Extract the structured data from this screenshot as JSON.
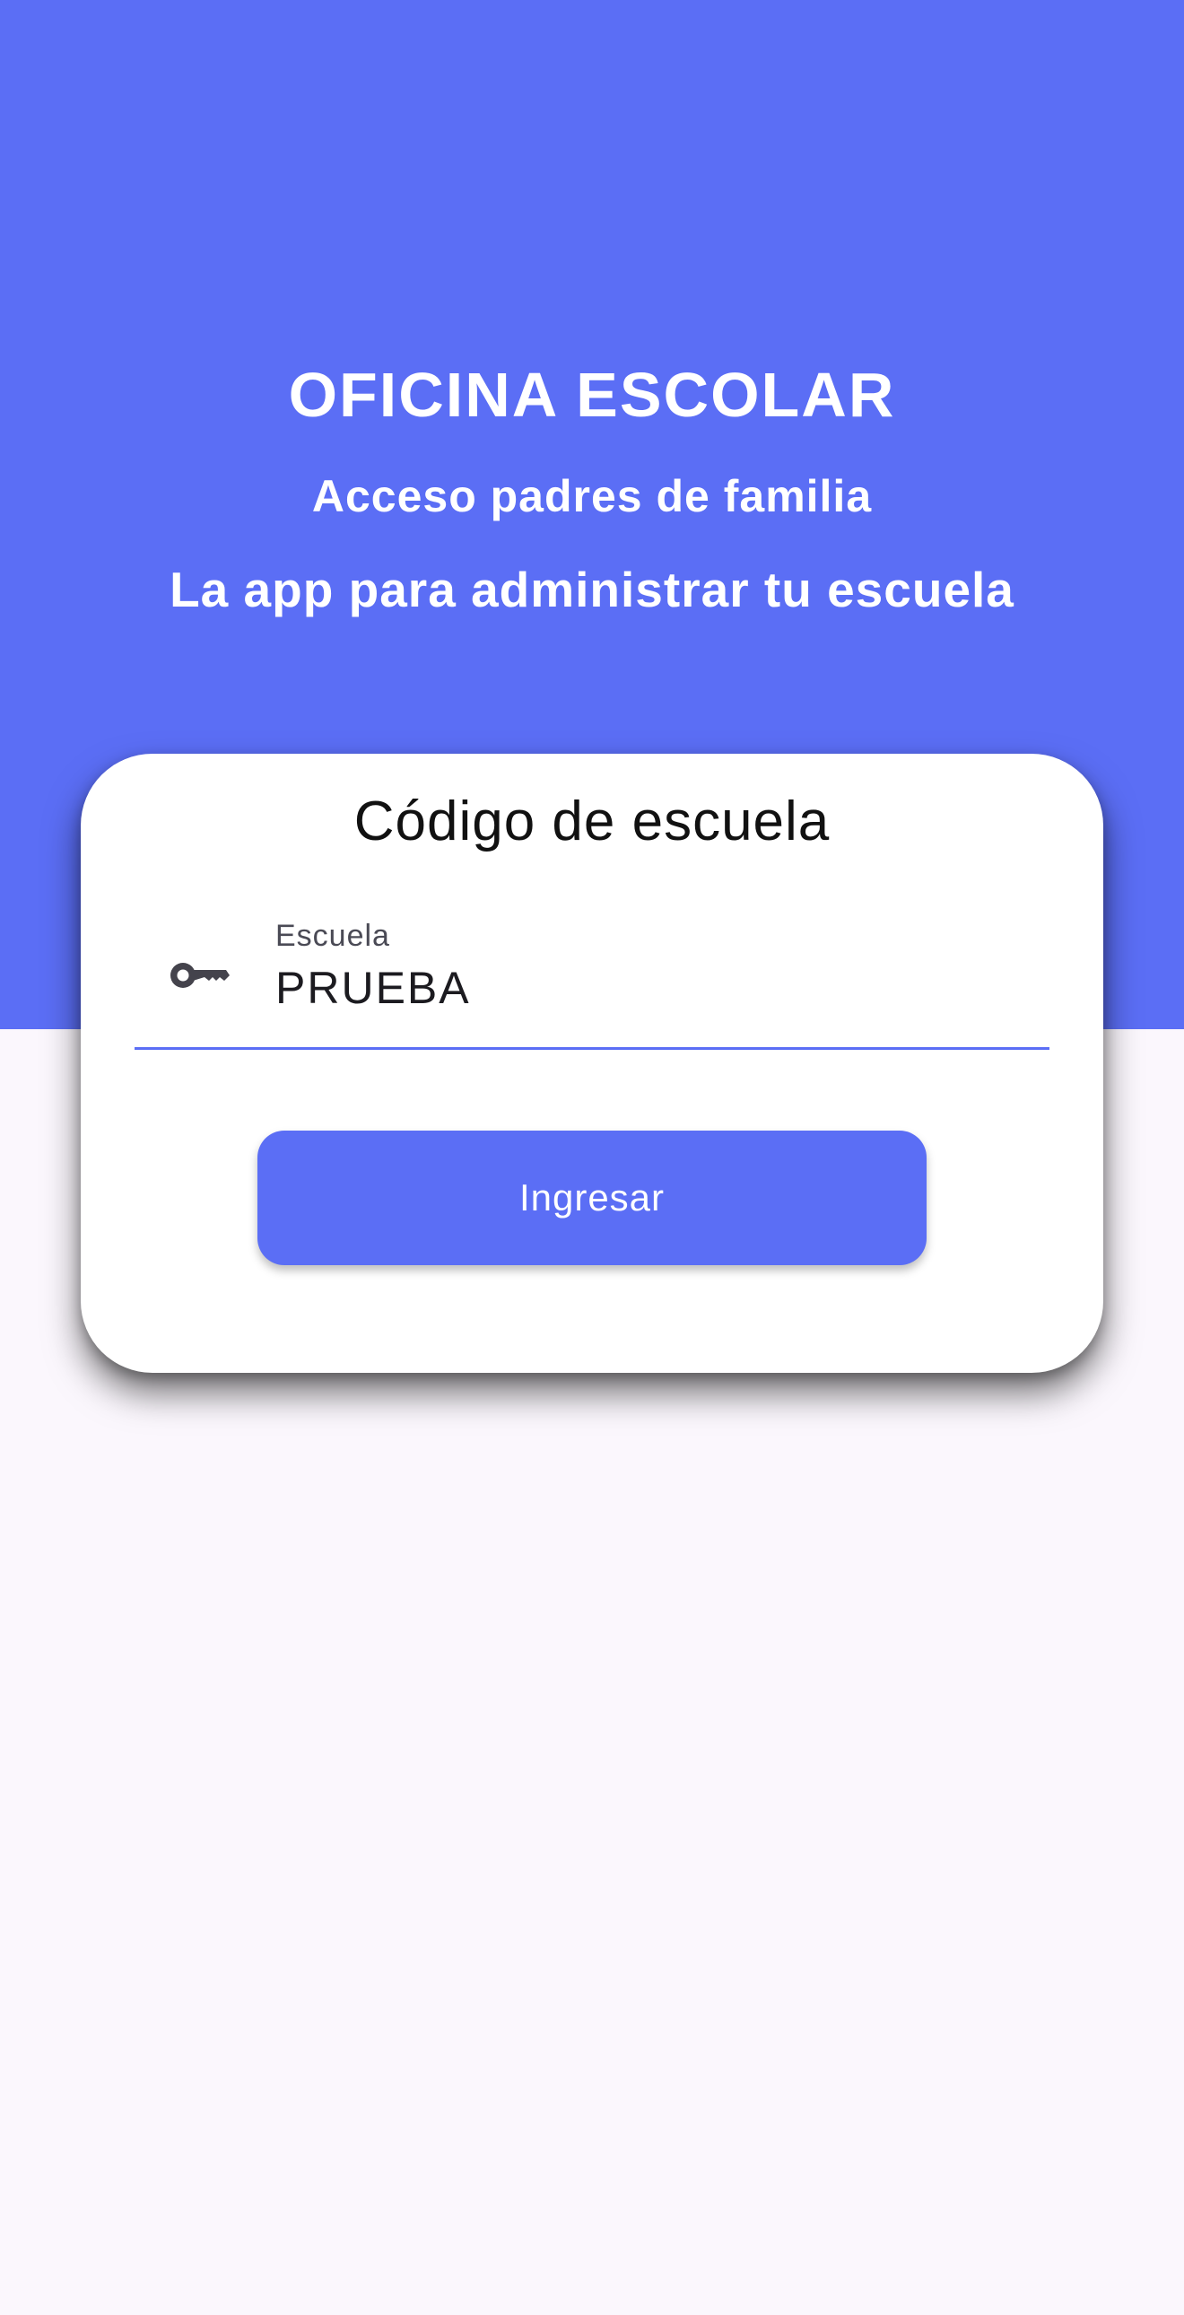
{
  "colors": {
    "primary": "#5b6ef5",
    "background": "#fbf7fd",
    "card": "#ffffff",
    "icon": "#44434c"
  },
  "header": {
    "title": "OFICINA ESCOLAR",
    "subtitle": "Acceso padres de familia",
    "tagline": "La app para administrar tu escuela"
  },
  "card": {
    "title": "Código de escuela",
    "field": {
      "icon": "key-icon",
      "label": "Escuela",
      "value": "PRUEBA"
    },
    "submit_label": "Ingresar"
  }
}
